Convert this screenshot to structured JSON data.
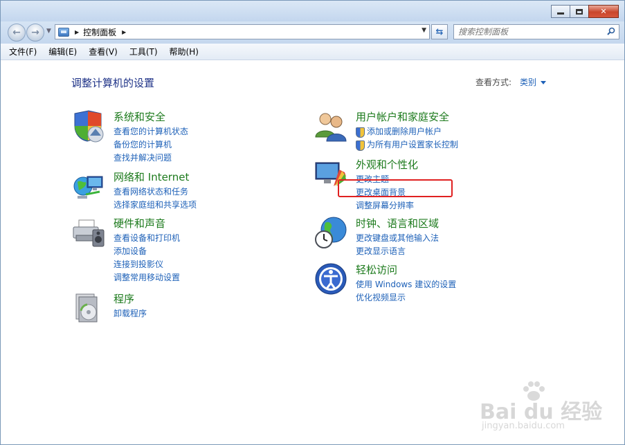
{
  "window": {
    "controls": {
      "minimize_icon": "minimize-icon",
      "maximize_icon": "maximize-icon",
      "close_icon": "close-icon"
    }
  },
  "address_bar": {
    "breadcrumb": "控制面板",
    "search_placeholder": "搜索控制面板"
  },
  "menu": [
    "文件(F)",
    "编辑(E)",
    "查看(V)",
    "工具(T)",
    "帮助(H)"
  ],
  "page": {
    "title": "调整计算机的设置",
    "view_by_label": "查看方式:",
    "view_by_value": "类别"
  },
  "categories": {
    "system_security": {
      "title": "系统和安全",
      "links": [
        "查看您的计算机状态",
        "备份您的计算机",
        "查找并解决问题"
      ]
    },
    "network": {
      "title": "网络和 Internet",
      "links": [
        "查看网络状态和任务",
        "选择家庭组和共享选项"
      ]
    },
    "hardware": {
      "title": "硬件和声音",
      "links": [
        "查看设备和打印机",
        "添加设备",
        "连接到投影仪",
        "调整常用移动设置"
      ]
    },
    "programs": {
      "title": "程序",
      "links": [
        "卸载程序"
      ]
    },
    "user_accounts": {
      "title": "用户帐户和家庭安全",
      "links": [
        "添加或删除用户帐户",
        "为所有用户设置家长控制"
      ]
    },
    "appearance": {
      "title": "外观和个性化",
      "links": [
        "更改主题",
        "更改桌面背景",
        "调整屏幕分辨率"
      ]
    },
    "clock": {
      "title": "时钟、语言和区域",
      "links": [
        "更改键盘或其他输入法",
        "更改显示语言"
      ]
    },
    "ease": {
      "title": "轻松访问",
      "links": [
        "使用 Windows 建议的设置",
        "优化视频显示"
      ]
    }
  },
  "watermark": {
    "logo": "Bai du 经验",
    "url": "jingyan.baidu.com"
  },
  "colors": {
    "category_title": "#1c7a1c",
    "link": "#1e61b8",
    "heading": "#1e3287",
    "highlight": "#e02020"
  }
}
